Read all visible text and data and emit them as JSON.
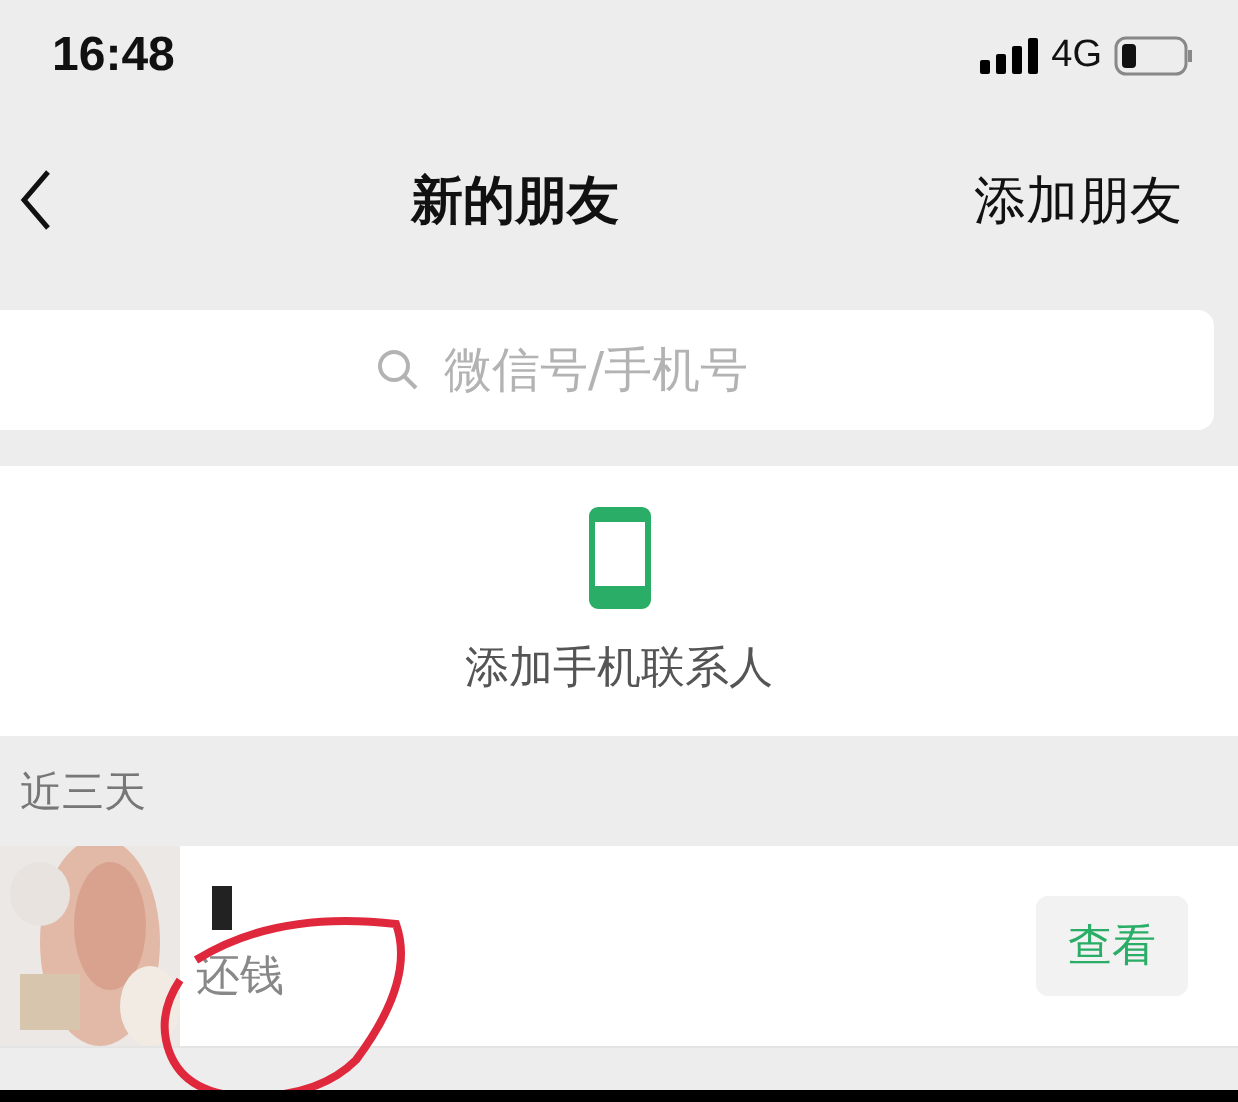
{
  "status_bar": {
    "time": "16:48",
    "network": "4G"
  },
  "nav": {
    "title": "新的朋友",
    "action": "添加朋友"
  },
  "search": {
    "placeholder": "微信号/手机号"
  },
  "add_contacts": {
    "label": "添加手机联系人"
  },
  "section": {
    "title": "近三天"
  },
  "requests": [
    {
      "message": "还钱",
      "button": "查看"
    }
  ]
}
